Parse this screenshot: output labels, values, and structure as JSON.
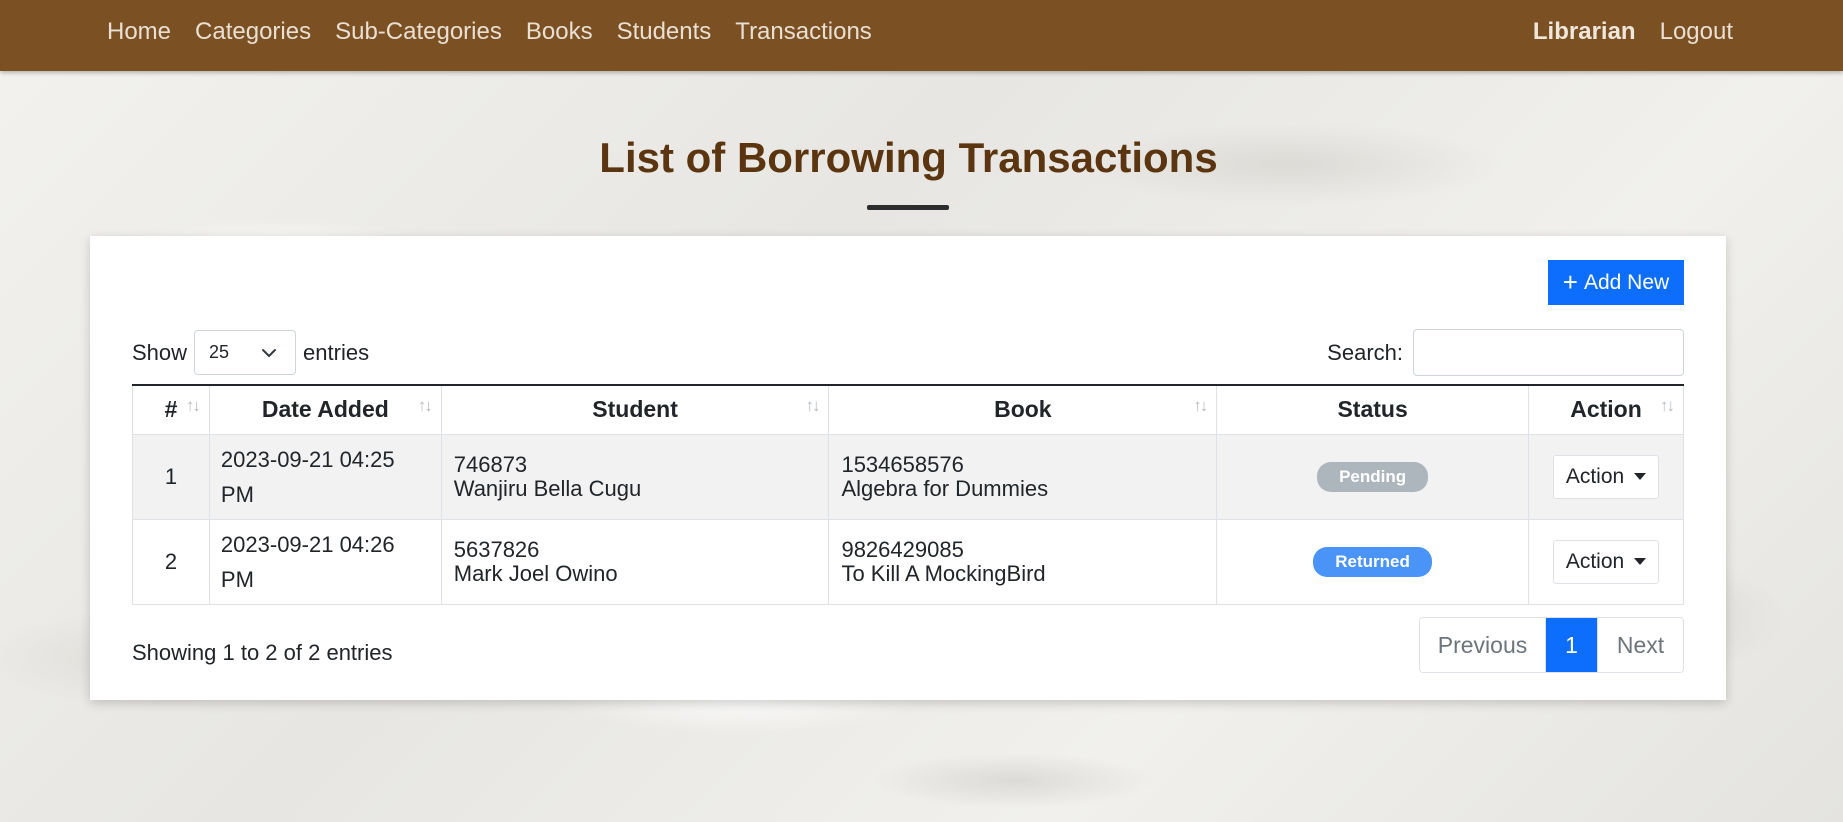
{
  "navbar": {
    "links": [
      "Home",
      "Categories",
      "Sub-Categories",
      "Books",
      "Students",
      "Transactions"
    ],
    "user": "Librarian",
    "logout": "Logout"
  },
  "page": {
    "title": "List of Borrowing Transactions"
  },
  "toolbar": {
    "add_label": "Add New",
    "add_icon": "plus-icon",
    "show_label": "Show",
    "entries_value": "25",
    "entries_label": "entries",
    "search_label": "Search:",
    "search_value": ""
  },
  "table": {
    "columns": [
      "#",
      "Date Added",
      "Student",
      "Book",
      "Status",
      "Action"
    ],
    "rows": [
      {
        "num": "1",
        "date": "2023-09-21 04:25 PM",
        "student_code": "746873",
        "student_name": "Wanjiru Bella Cugu",
        "book_code": "1534658576",
        "book_title": "Algebra for Dummies",
        "status": "Pending",
        "action": "Action"
      },
      {
        "num": "2",
        "date": "2023-09-21 04:26 PM",
        "student_code": "5637826",
        "student_name": "Mark Joel Owino",
        "book_code": "9826429085",
        "book_title": "To Kill A MockingBird",
        "status": "Returned",
        "action": "Action"
      }
    ]
  },
  "footer": {
    "info": "Showing 1 to 2 of 2 entries",
    "previous": "Previous",
    "current_page": "1",
    "next": "Next"
  },
  "colors": {
    "navbar": "#7b5124",
    "title": "#5b3510",
    "primary": "#0d6efd",
    "pending": "#adb5bd",
    "returned": "#4a93f7"
  }
}
